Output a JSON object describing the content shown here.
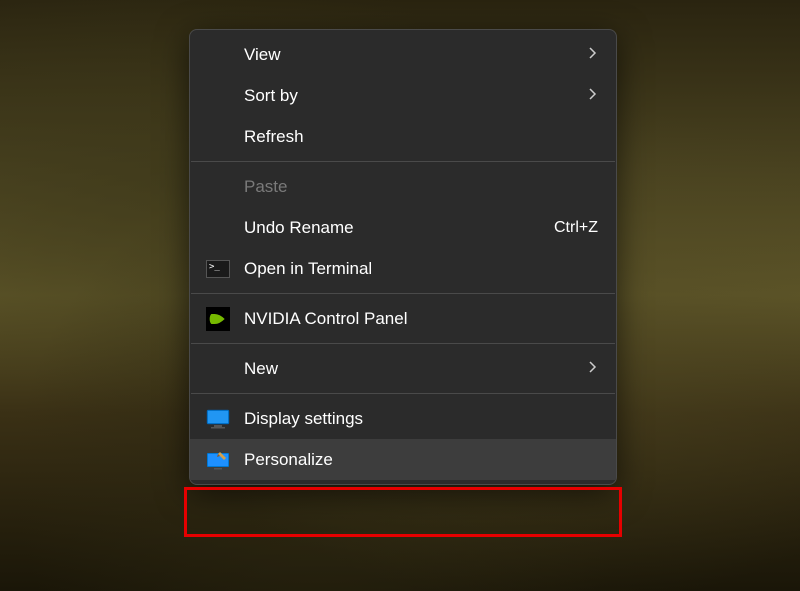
{
  "menu": {
    "items": [
      {
        "label": "View",
        "hasSubmenu": true
      },
      {
        "label": "Sort by",
        "hasSubmenu": true
      },
      {
        "label": "Refresh"
      },
      {
        "separator": true
      },
      {
        "label": "Paste",
        "disabled": true
      },
      {
        "label": "Undo Rename",
        "shortcut": "Ctrl+Z"
      },
      {
        "label": "Open in Terminal",
        "icon": "terminal"
      },
      {
        "separator": true
      },
      {
        "label": "NVIDIA Control Panel",
        "icon": "nvidia"
      },
      {
        "separator": true
      },
      {
        "label": "New",
        "hasSubmenu": true
      },
      {
        "separator": true
      },
      {
        "label": "Display settings",
        "icon": "display"
      },
      {
        "label": "Personalize",
        "icon": "personalize",
        "highlighted": true
      }
    ]
  }
}
